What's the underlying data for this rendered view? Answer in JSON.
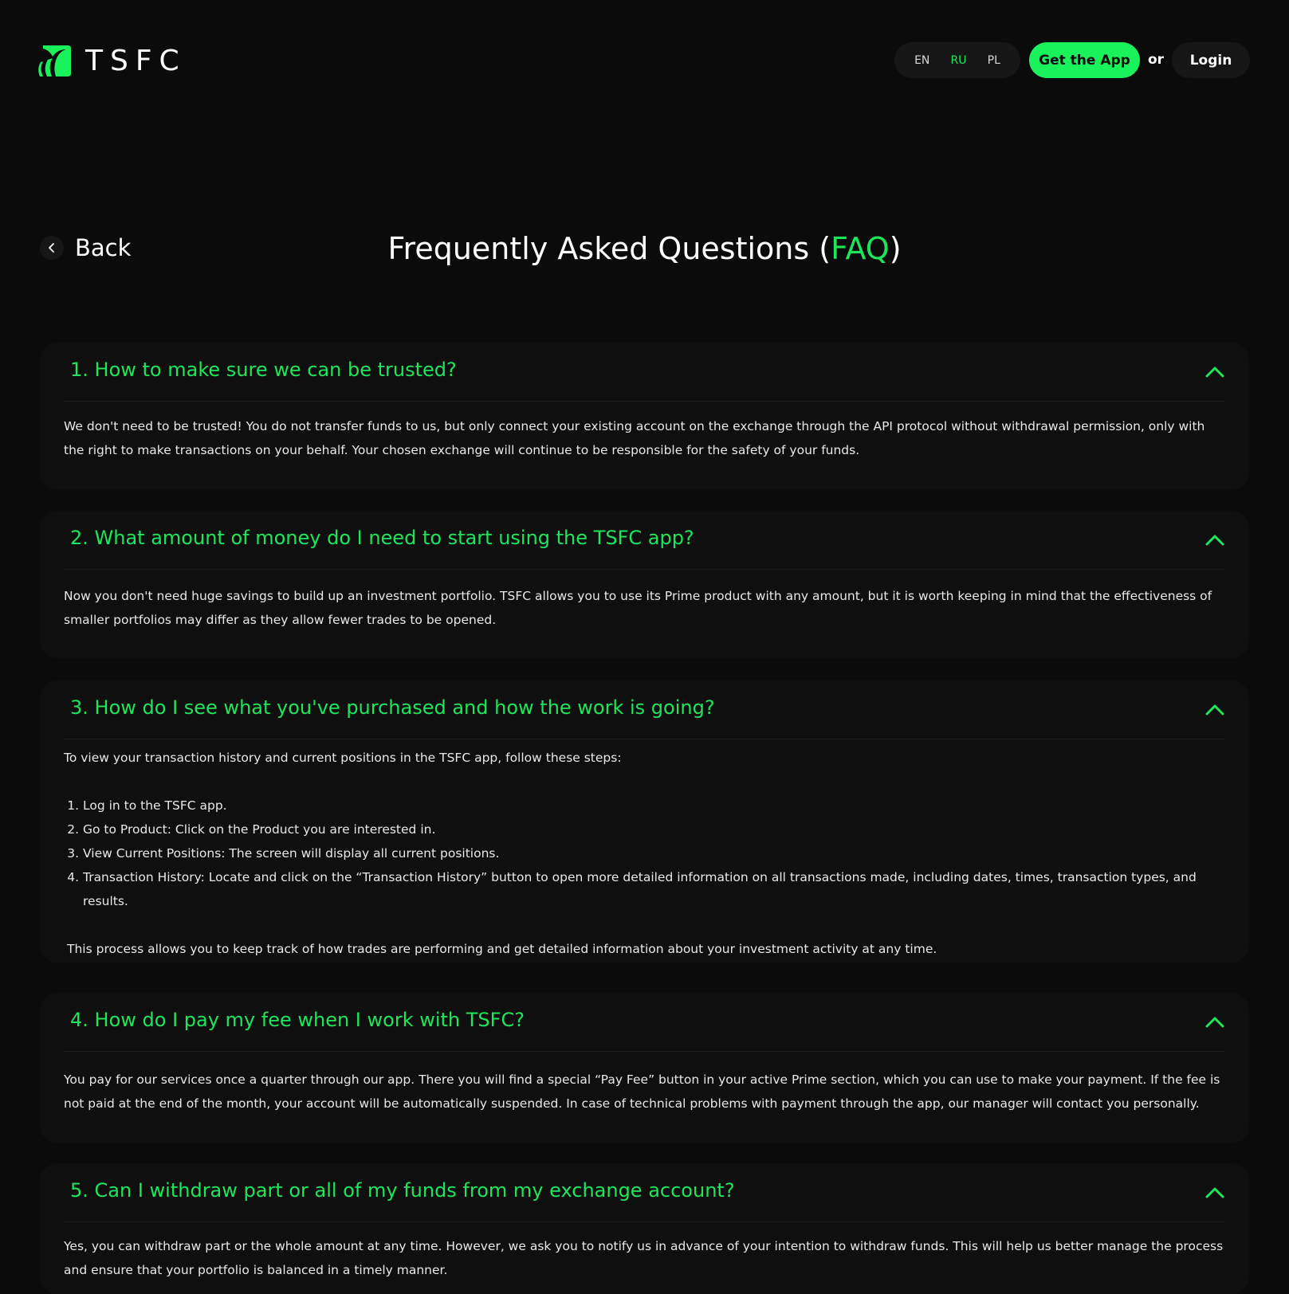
{
  "header": {
    "logo_text": "TSFC",
    "languages": [
      "EN",
      "RU",
      "PL"
    ],
    "active_language": "RU",
    "get_app_label": "Get the App",
    "or_label": "or",
    "login_label": "Login"
  },
  "title_row": {
    "back_label": "Back",
    "title_prefix": "Frequently Asked Questions (",
    "title_accent": "FAQ",
    "title_suffix": ")"
  },
  "faq": [
    {
      "question": "1. How to make sure we can be trusted?",
      "answer": "We don't need to be trusted! You do not transfer funds to us, but only connect your existing account on the exchange through the API protocol without withdrawal permission, only with the right to make transactions on your behalf. Your chosen exchange will continue to be responsible for the safety of your funds."
    },
    {
      "question": "2. What amount of money do I need to start using the TSFC app?",
      "answer": "Now you don't need huge savings to build up an investment portfolio. TSFC allows you to use its Prime product with any amount, but it is worth keeping in mind that the effectiveness of smaller portfolios may differ as they allow fewer trades to be opened."
    },
    {
      "question": "3. How do I see what you've purchased and how the work is going?",
      "intro": "To view your transaction history and current positions in the TSFC app, follow these steps:",
      "steps": [
        "Log in to the TSFC app.",
        "Go to Product: Click on the Product you are interested in.",
        "View Current Positions: The screen will display all current positions.",
        "Transaction History: Locate and click on the “Transaction History” button to open more detailed information on all transactions made, including dates, times, transaction types, and results."
      ],
      "outro": "This process allows you to keep track of how trades are performing and get detailed information about your investment activity at any time."
    },
    {
      "question": "4. How do I pay my fee when I work with TSFC?",
      "answer": "You pay for our services once a quarter through our app. There you will find a special “Pay Fee” button in your active Prime section, which you can use to make your payment. If the fee is not paid at the end of the month, your account will be automatically suspended. In case of technical problems with payment through the app, our manager will contact you personally."
    },
    {
      "question": "5. Can I withdraw part or all of my funds from my exchange account?",
      "answer": "Yes, you can withdraw part or the whole amount at any time. However, we ask you to notify us in advance of your intention to withdraw funds. This will help us better manage the process and ensure that your portfolio is balanced in a timely manner."
    }
  ],
  "colors": {
    "accent": "#1ee65a",
    "button_accent": "#19f25a",
    "background": "#0b0b0c",
    "card": "#0f0f10"
  }
}
